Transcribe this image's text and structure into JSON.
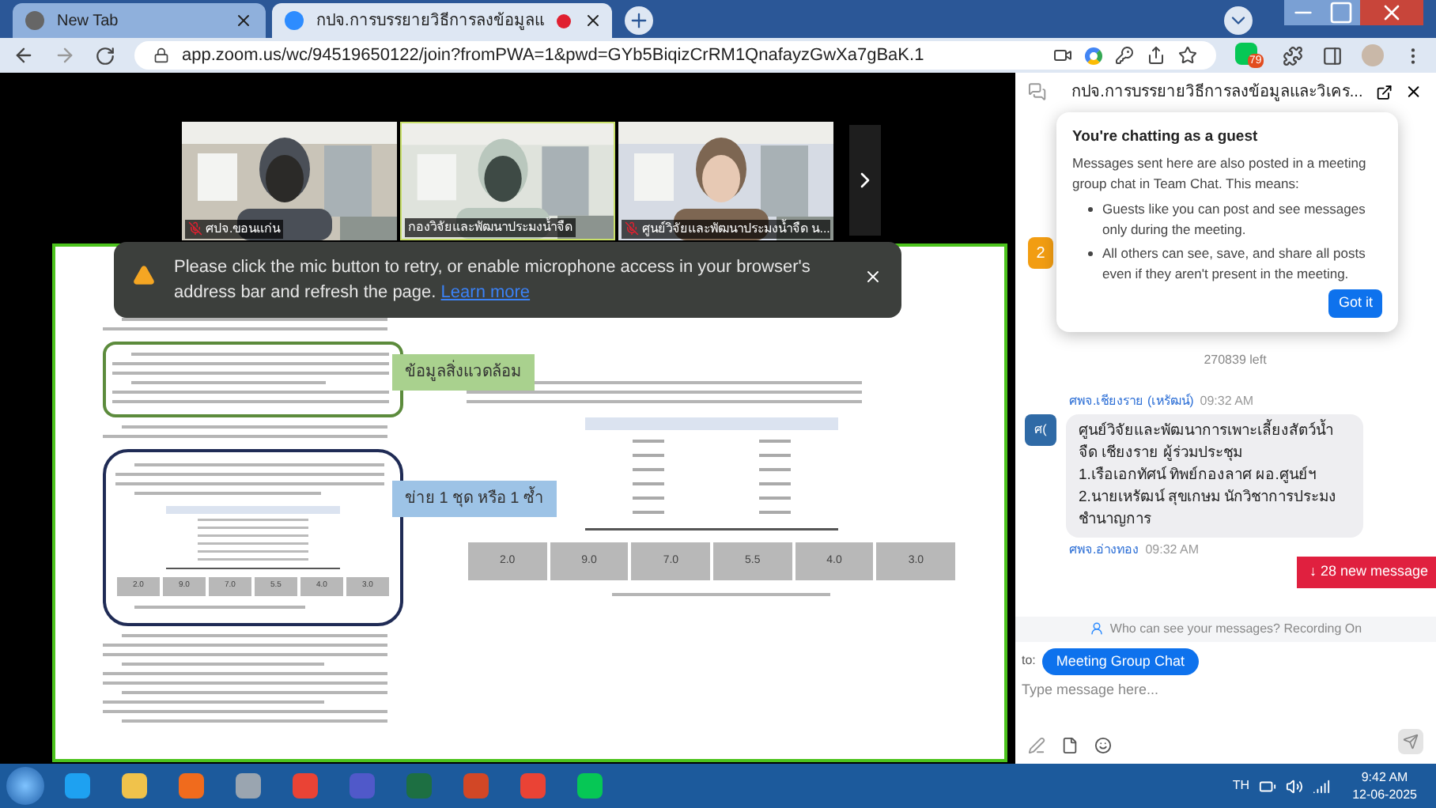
{
  "browser": {
    "tabs": [
      {
        "title": "New Tab",
        "selected": false
      },
      {
        "title": "กปจ.การบรรยายวิธีการลงข้อมูลแ",
        "selected": true
      }
    ],
    "url": "app.zoom.us/wc/94519650122/join?fromPWA=1&pwd=GYb5BiqizCrRM1QnafayzGwXa7gBaK.1",
    "extension_badge": "79"
  },
  "videos": [
    {
      "name": "ศปจ.ขอนแก่น",
      "muted": true,
      "selected": false
    },
    {
      "name": "กองวิจัยและพัฒนาประมงน้ำจืด",
      "muted": false,
      "selected": true
    },
    {
      "name": "ศูนย์วิจัยและพัฒนาประมงน้ำจืด น...",
      "muted": true,
      "selected": false
    }
  ],
  "warning": {
    "text": "Please click the mic button to retry, or enable microphone access in your browser's address bar and refresh the page.",
    "link": "Learn more"
  },
  "document": {
    "callouts": [
      "ข้อมูลสิ่งแวดล้อม",
      "ข่าย 1 ชุด หรือ 1 ซ้ำ"
    ],
    "left_net_sizes": [
      "2.0",
      "9.0",
      "7.0",
      "5.5",
      "4.0",
      "3.0"
    ],
    "right_net_sizes": [
      "2.0",
      "9.0",
      "7.0",
      "5.5",
      "4.0",
      "3.0"
    ]
  },
  "chat": {
    "title": "กปจ.การบรรยายวิธีการลงข้อมูลและวิเคร...",
    "unread_badge": "2",
    "guest_popup": {
      "title": "You're chatting as a guest",
      "intro": "Messages sent here are also posted in a meeting group chat in Team Chat. This means:",
      "points": [
        "Guests like you can post and see messages only during the meeting.",
        "All others can see, save, and share all posts even if they aren't present in the meeting."
      ],
      "button": "Got it"
    },
    "remaining": "270839 left",
    "messages": [
      {
        "sender": "ศพจ.เชียงราย (เหรัฒน์)",
        "time": "09:32 AM",
        "avatar": "ศ(",
        "lines": [
          "ศูนย์วิจัยและพัฒนาการเพาะเลี้ยงสัตว์น้ำจืด เชียงราย ผู้ร่วมประชุม",
          "1.เรือเอกทัศน์ ทิพย์กองลาศ ผอ.ศูนย์ฯ",
          "2.นายเหรัฒน์ สุขเกษม นักวิชาการประมง ชำนาญการ"
        ]
      },
      {
        "sender": "ศพจ.อ่างทอง",
        "time": "09:32 AM"
      }
    ],
    "new_messages": "↓ 28 new message",
    "privacy_note": "Who can see your messages? Recording On",
    "to_label": "to:",
    "recipient": "Meeting Group Chat",
    "placeholder": "Type message here..."
  },
  "taskbar": {
    "language": "TH",
    "time": "9:42 AM",
    "date": "12-06-2025"
  }
}
